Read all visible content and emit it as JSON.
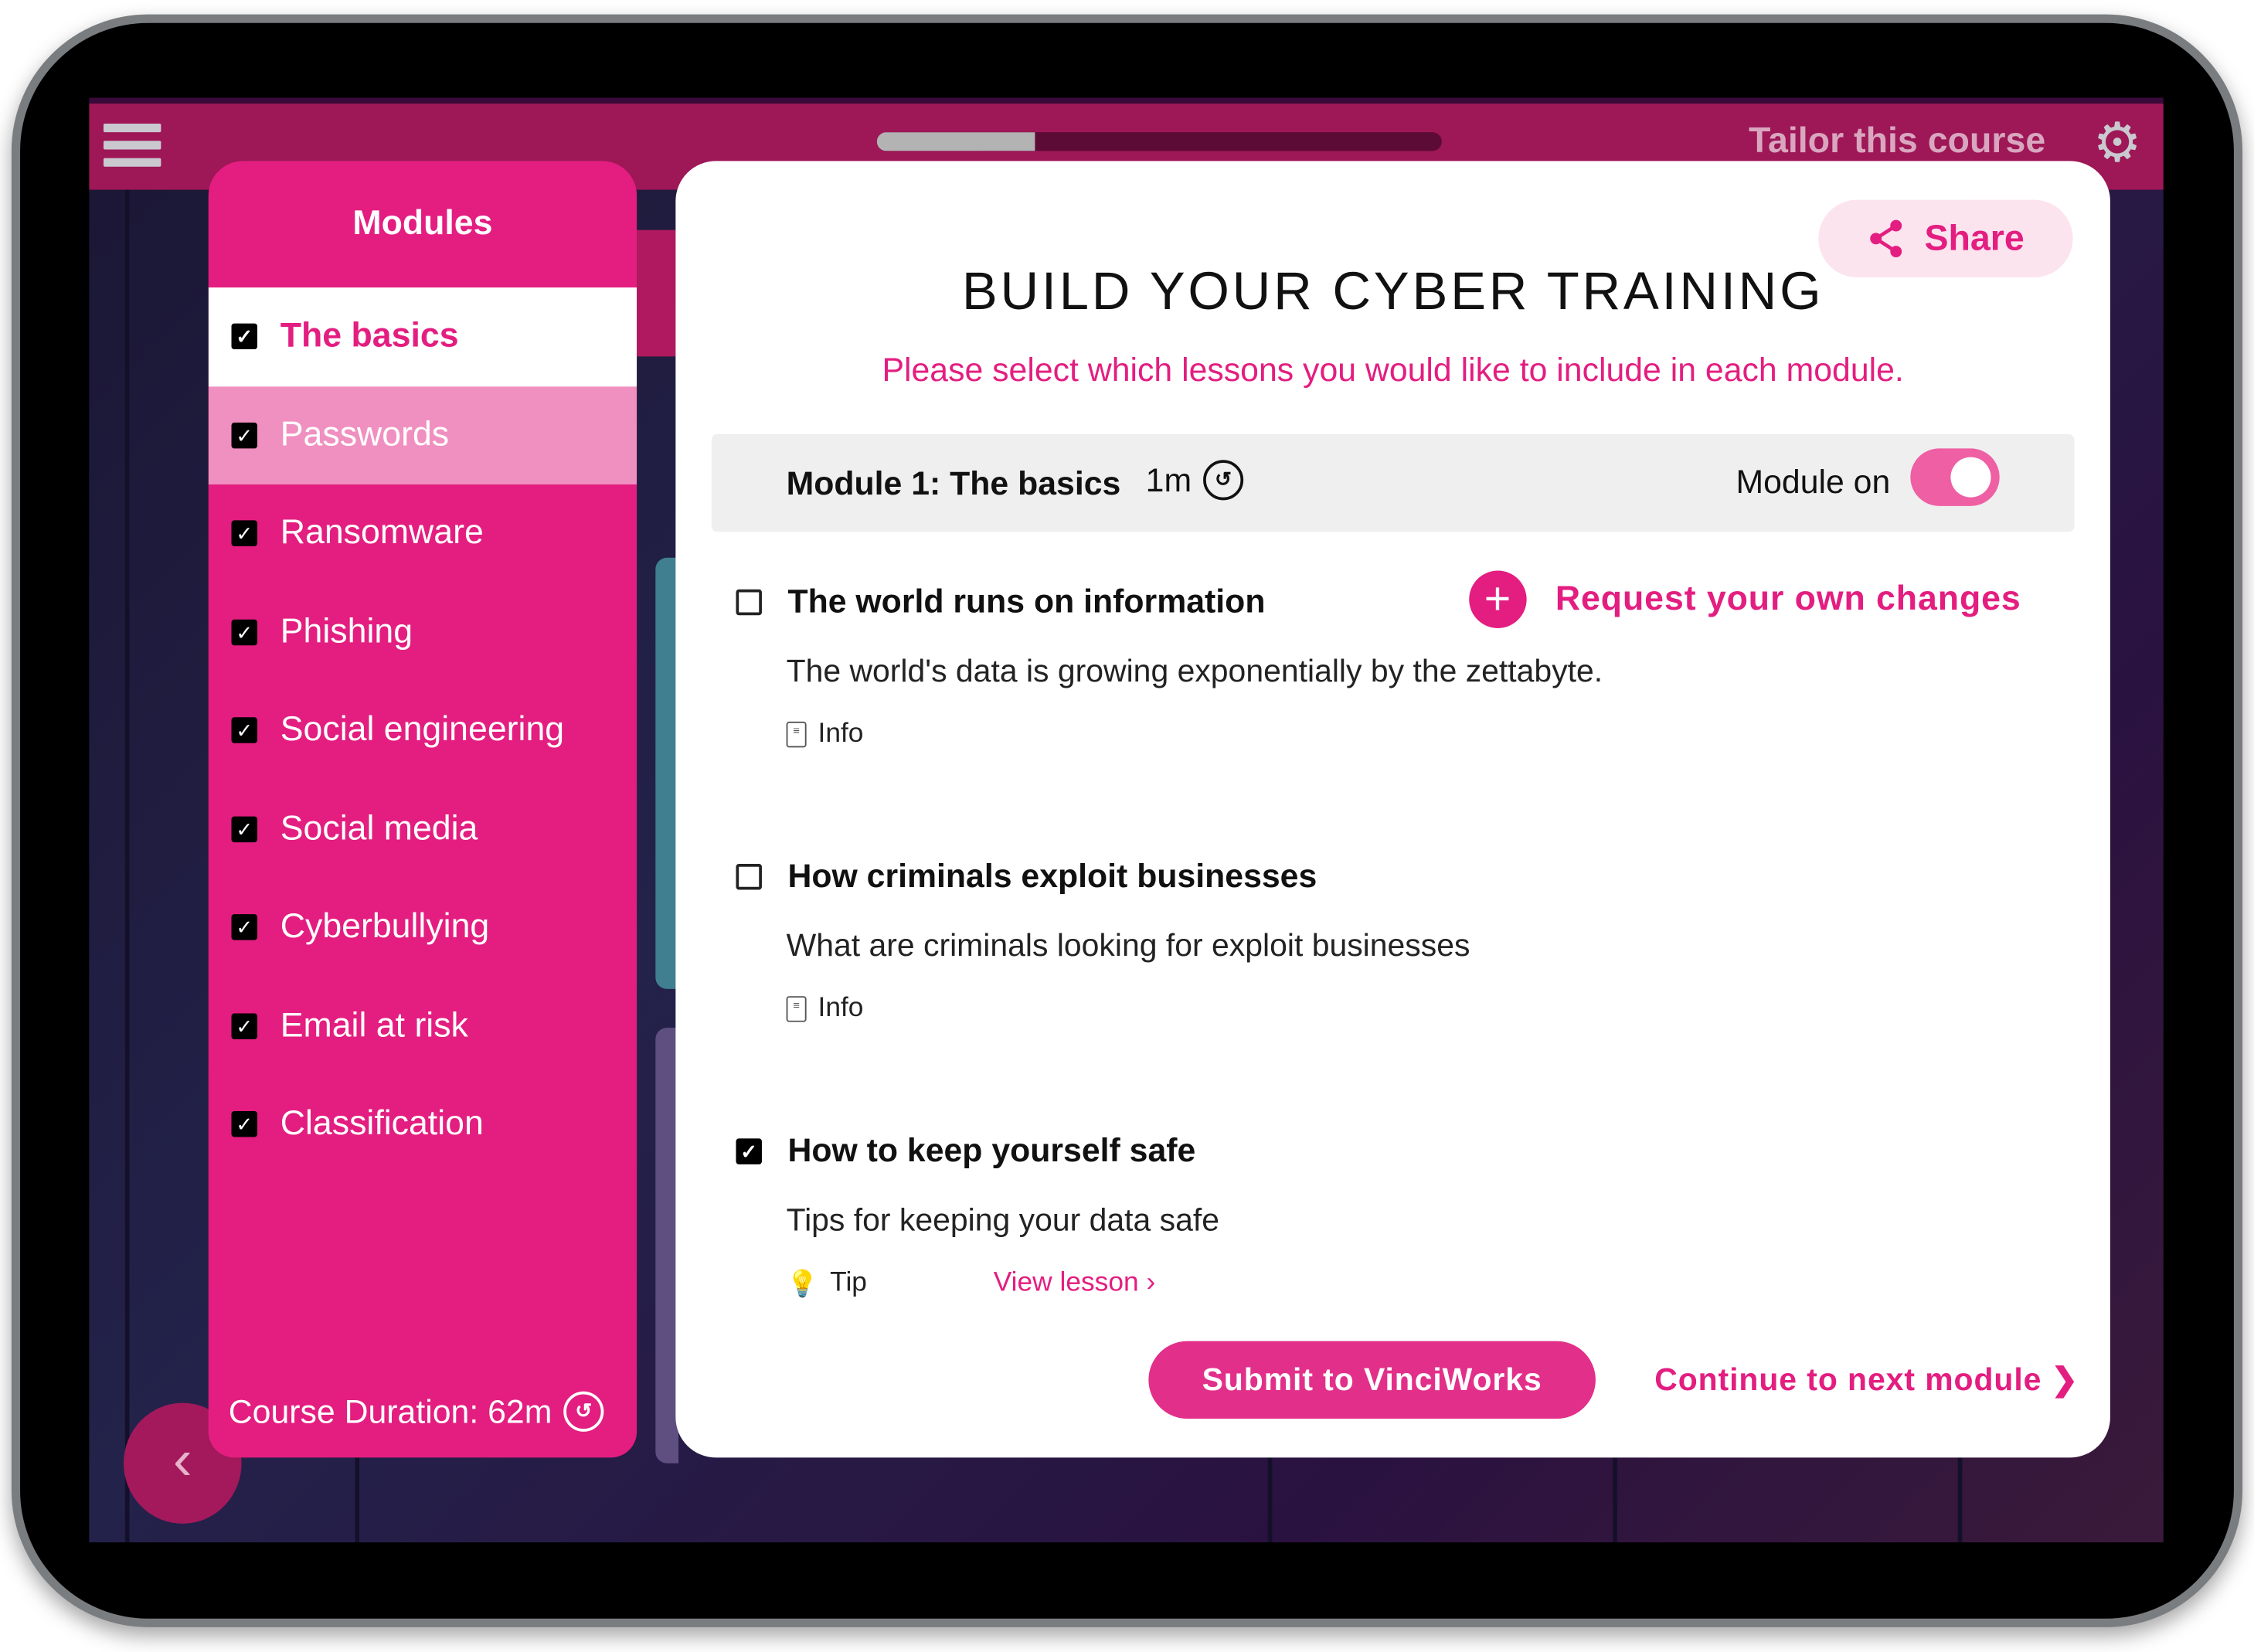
{
  "header": {
    "progress_percent": 28,
    "tailor_label": "Tailor this course",
    "settings_icon": "gear-icon",
    "menu_icon": "hamburger-icon"
  },
  "sidebar": {
    "title": "Modules",
    "items": [
      {
        "label": "The basics",
        "checked": true,
        "state": "active"
      },
      {
        "label": "Passwords",
        "checked": true,
        "state": "hover"
      },
      {
        "label": "Ransomware",
        "checked": true
      },
      {
        "label": "Phishing",
        "checked": true
      },
      {
        "label": "Social engineering",
        "checked": true
      },
      {
        "label": "Social media",
        "checked": true
      },
      {
        "label": "Cyberbullying",
        "checked": true
      },
      {
        "label": "Email at risk",
        "checked": true
      },
      {
        "label": "Classification",
        "checked": true
      }
    ],
    "duration": "Course Duration: 62m"
  },
  "main": {
    "share_label": "Share",
    "title": "BUILD YOUR CYBER TRAINING",
    "subtitle": "Please select which lessons you would like to include in each module.",
    "module": {
      "name": "Module 1: The basics",
      "duration": "1m",
      "toggle_label": "Module on",
      "toggle_on": true
    },
    "request_label": "Request your own changes",
    "lessons": [
      {
        "title": "The world runs on information",
        "desc": "The world's data is growing exponentially by the zettabyte.",
        "meta": "Info",
        "checked": false
      },
      {
        "title": "How criminals exploit businesses",
        "desc": "What are criminals looking for exploit businesses",
        "meta": "Info",
        "checked": false
      },
      {
        "title": "How to keep yourself safe",
        "desc": "Tips for keeping your data safe",
        "meta": "Tip",
        "checked": true,
        "link": "View lesson ›"
      }
    ],
    "submit_label": "Submit to VinciWorks",
    "continue_label": "Continue to next module ❯"
  },
  "colors": {
    "accent": "#e31e80",
    "topbar": "#9e1757",
    "sidebar_hover": "#f090c0"
  }
}
